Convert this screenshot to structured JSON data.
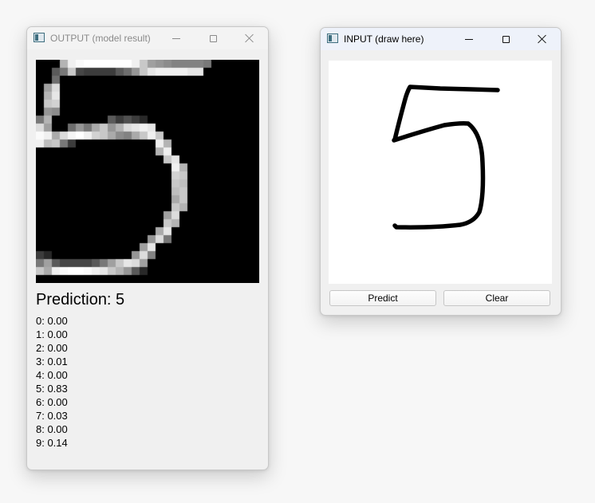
{
  "output_window": {
    "title": "OUTPUT (model result)",
    "prediction_text": "Prediction: 5",
    "probabilities": [
      {
        "text": "0: 0.00",
        "value": 0.0
      },
      {
        "text": "1: 0.00",
        "value": 0.0
      },
      {
        "text": "2: 0.00",
        "value": 0.0
      },
      {
        "text": "3: 0.01",
        "value": 0.01
      },
      {
        "text": "4: 0.00",
        "value": 0.0
      },
      {
        "text": "5: 0.83",
        "value": 0.83
      },
      {
        "text": "6: 0.00",
        "value": 0.0
      },
      {
        "text": "7: 0.03",
        "value": 0.03
      },
      {
        "text": "8: 0.00",
        "value": 0.0
      },
      {
        "text": "9: 0.14",
        "value": 0.14
      }
    ]
  },
  "input_window": {
    "title": "INPUT (draw here)",
    "predict_label": "Predict",
    "clear_label": "Clear"
  },
  "icons": {
    "app": "app-window-icon",
    "minimize": "minimize-icon",
    "maximize": "maximize-icon",
    "close": "close-icon"
  },
  "colors": {
    "output_bg": "#f0f0f0",
    "input_titlebar": "#eef2fa",
    "canvas_bg": "#ffffff",
    "digit_ink": "#000000",
    "output_image_bg": "#000000"
  }
}
